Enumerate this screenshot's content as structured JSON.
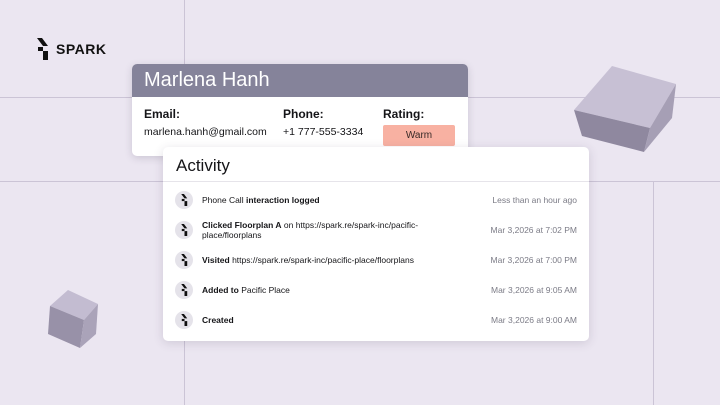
{
  "brand": {
    "name": "SPARK"
  },
  "contact": {
    "name": "Marlena Hanh",
    "email_label": "Email:",
    "email": "marlena.hanh@gmail.com",
    "phone_label": "Phone:",
    "phone": "+1 777-555-3334",
    "rating_label": "Rating:",
    "rating": "Warm"
  },
  "activity": {
    "title": "Activity",
    "items": [
      {
        "pre": "Phone Call ",
        "bold": "interaction logged",
        "post": "",
        "time": "Less than an hour ago"
      },
      {
        "pre": "",
        "bold": "Clicked Floorplan A",
        "post": " on https://spark.re/spark-inc/pacific-place/floorplans",
        "time": "Mar 3,2026 at 7:02 PM"
      },
      {
        "pre": "",
        "bold": "Visited",
        "post": " https://spark.re/spark-inc/pacific-place/floorplans",
        "time": "Mar 3,2026 at 7:00 PM"
      },
      {
        "pre": "",
        "bold": "Added to",
        "post": " Pacific Place",
        "time": "Mar 3,2026 at 9:05 AM"
      },
      {
        "pre": "",
        "bold": "Created",
        "post": "",
        "time": "Mar 3,2026 at 9:00 AM"
      }
    ]
  },
  "colors": {
    "background": "#ebe6f1",
    "header": "#85839a",
    "rating_badge": "#f8b1a2",
    "cube": "#a69fb5"
  },
  "icons": {
    "brand": "spark-logo-icon",
    "activity_row": "spark-logo-icon"
  }
}
